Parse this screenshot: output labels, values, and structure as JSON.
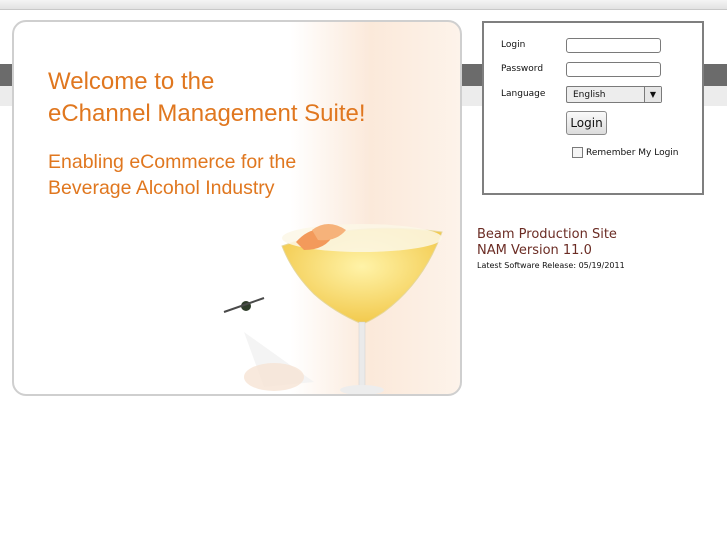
{
  "hero": {
    "welcome_line1": "Welcome to the",
    "welcome_line2": "eChannel Management Suite!",
    "tagline_line1": "Enabling eCommerce for the",
    "tagline_line2": "Beverage Alcohol Industry"
  },
  "login": {
    "login_label": "Login",
    "login_value": "",
    "password_label": "Password",
    "password_value": "",
    "language_label": "Language",
    "language_selected": "English",
    "submit_label": "Login",
    "remember_label": "Remember My Login",
    "remember_checked": false
  },
  "site_info": {
    "name": "Beam Production Site",
    "version": "NAM Version 11.0",
    "release": "Latest Software Release: 05/19/2011"
  },
  "colors": {
    "accent": "#e0771f",
    "site_text": "#6b2c24",
    "band": "#6b6b6b"
  },
  "icons": {
    "dropdown": "triangle-down",
    "hero_image": "margarita-glass"
  }
}
